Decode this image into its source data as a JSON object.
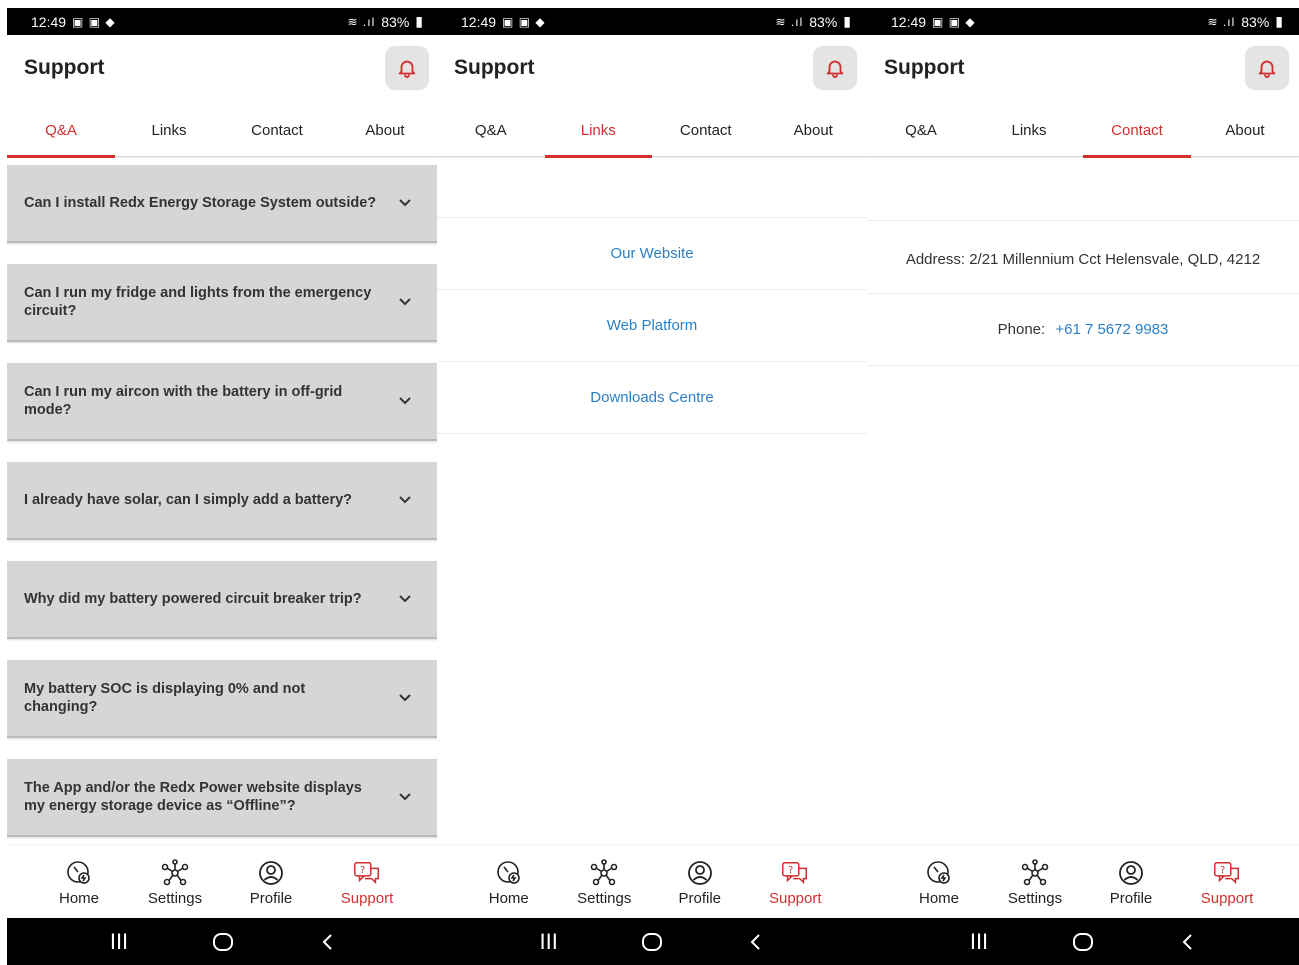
{
  "status": {
    "time": "12:49",
    "battery": "83%"
  },
  "appbar": {
    "title": "Support"
  },
  "tabs": [
    "Q&A",
    "Links",
    "Contact",
    "About"
  ],
  "qa": {
    "questions": [
      "Can I install Redx Energy Storage System outside?",
      "Can I run my fridge and lights from the emergency circuit?",
      "Can I run my aircon with the battery in off-grid mode?",
      "I already have solar, can I simply add a battery?",
      "Why did my battery powered circuit breaker trip?",
      "My battery SOC is displaying 0% and not changing?",
      "The App and/or the Redx Power website displays my energy storage device as “Offline”?"
    ]
  },
  "links": {
    "items": [
      "Our Website",
      "Web Platform",
      "Downloads Centre"
    ]
  },
  "contact": {
    "address": "Address: 2/21 Millennium Cct Helensvale, QLD, 4212",
    "phone_label": "Phone:",
    "phone_number": "+61 7 5672 9983"
  },
  "nav": {
    "home": "Home",
    "settings": "Settings",
    "profile": "Profile",
    "support": "Support"
  },
  "colors": {
    "accent": "#d32f2f",
    "link": "#2a7fc6",
    "card": "#d6d6d6"
  }
}
